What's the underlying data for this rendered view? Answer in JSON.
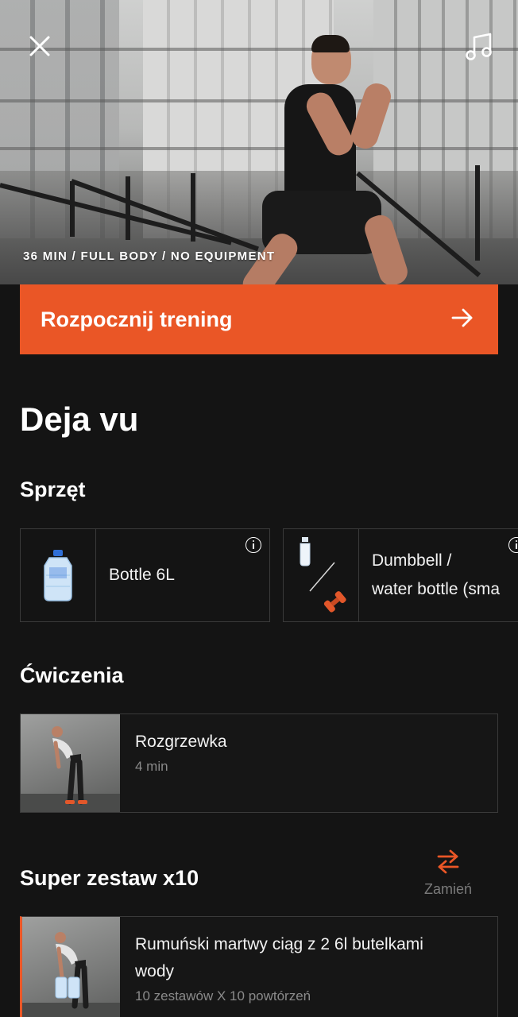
{
  "hero": {
    "meta": "36 MIN / FULL BODY / NO EQUIPMENT",
    "close_icon": "close-icon",
    "music_icon": "music-note-icon"
  },
  "cta": {
    "label": "Rozpocznij trening",
    "icon": "arrow-right-icon",
    "color": "#ea5626"
  },
  "workout": {
    "title": "Deja vu"
  },
  "equipment": {
    "heading": "Sprzęt",
    "items": [
      {
        "label": "Bottle 6L",
        "icon": "water-jug-icon"
      },
      {
        "label_line1": "Dumbbell /",
        "label_line2": "water bottle (sma",
        "icon": "dumbbell-bottle-icon"
      }
    ]
  },
  "exercises": {
    "heading": "Ćwiczenia",
    "items": [
      {
        "name": "Rozgrzewka",
        "duration": "4 min"
      }
    ]
  },
  "superset": {
    "heading": "Super zestaw x10",
    "swap_label": "Zamień",
    "swap_icon": "swap-arrows-icon",
    "items": [
      {
        "name_line1": "Rumuński martwy ciąg z 2 6l butelkami",
        "name_line2": "wody",
        "detail": "10 zestawów X 10 powtórzeń"
      }
    ]
  }
}
